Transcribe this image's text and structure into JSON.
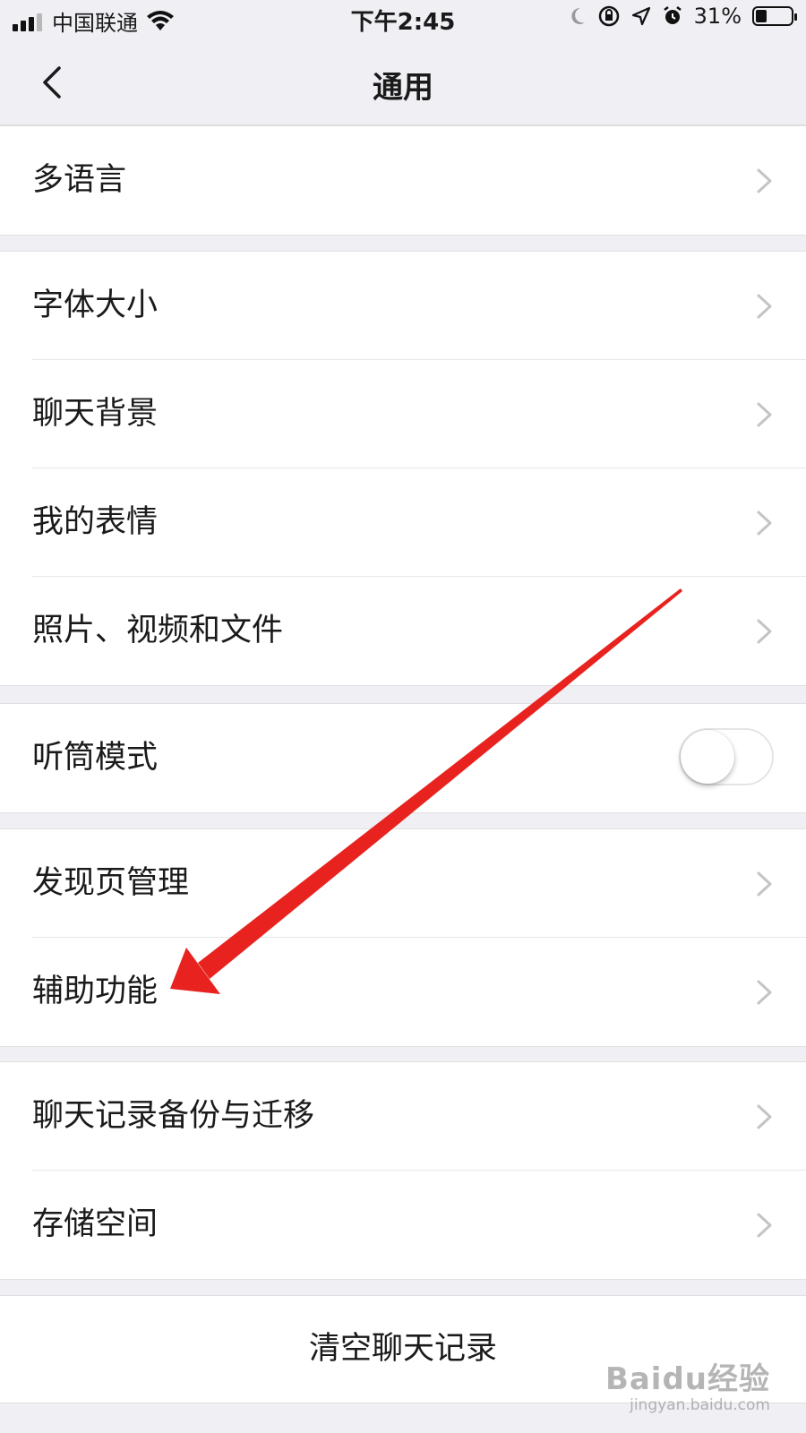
{
  "status_bar": {
    "carrier": "中国联通",
    "time": "下午2:45",
    "battery": "31%",
    "battery_level": 0.31,
    "icons": [
      "signal-icon",
      "wifi-icon",
      "moon-icon",
      "orientation-lock-icon",
      "location-icon",
      "alarm-icon",
      "battery-icon"
    ]
  },
  "nav": {
    "title": "通用",
    "back_icon": "back-chevron-icon"
  },
  "groups": [
    {
      "items": [
        {
          "label": "多语言",
          "accessory": "chevron-right-icon"
        }
      ]
    },
    {
      "items": [
        {
          "label": "字体大小",
          "accessory": "chevron-right-icon"
        },
        {
          "label": "聊天背景",
          "accessory": "chevron-right-icon"
        },
        {
          "label": "我的表情",
          "accessory": "chevron-right-icon"
        },
        {
          "label": "照片、视频和文件",
          "accessory": "chevron-right-icon"
        }
      ]
    },
    {
      "items": [
        {
          "label": "听筒模式",
          "accessory": "toggle",
          "toggle_on": false
        }
      ]
    },
    {
      "items": [
        {
          "label": "发现页管理",
          "accessory": "chevron-right-icon"
        },
        {
          "label": "辅助功能",
          "accessory": "chevron-right-icon"
        }
      ]
    },
    {
      "items": [
        {
          "label": "聊天记录备份与迁移",
          "accessory": "chevron-right-icon"
        },
        {
          "label": "存储空间",
          "accessory": "chevron-right-icon"
        }
      ]
    }
  ],
  "clear_chat": {
    "label": "清空聊天记录"
  },
  "annotation": {
    "arrow_color": "#e8231f"
  },
  "watermark": {
    "logo": "Baidu经验",
    "url": "jingyan.baidu.com"
  },
  "colors": {
    "background": "#efeff4",
    "cell": "#ffffff",
    "chevron": "#c4c4c6"
  }
}
